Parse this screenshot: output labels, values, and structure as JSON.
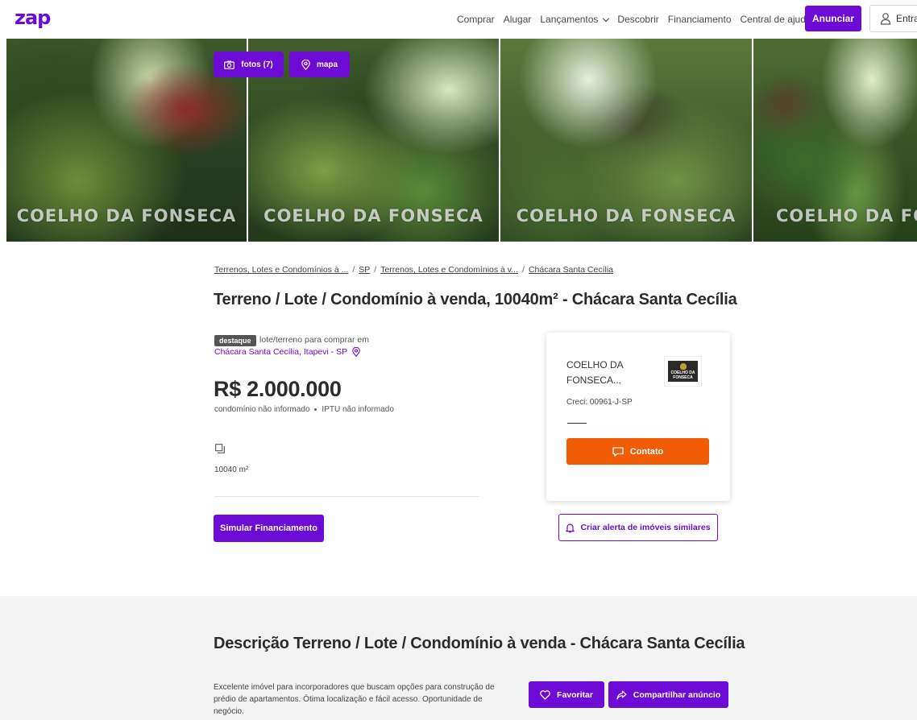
{
  "header": {
    "logo": "zap",
    "nav": [
      {
        "label": "Comprar"
      },
      {
        "label": "Alugar"
      },
      {
        "label": "Lançamentos",
        "dropdown": true
      },
      {
        "label": "Descobrir"
      },
      {
        "label": "Financiamento"
      },
      {
        "label": "Central de ajuda"
      }
    ],
    "anunciar_label": "Anunciar",
    "entrar_label": "Entrar"
  },
  "gallery": {
    "fotos_label": "fotos (7)",
    "mapa_label": "mapa",
    "watermark": "COELHO DA FONSECA"
  },
  "breadcrumb": [
    "Terrenos, Lotes e Condomínios à ...",
    "SP",
    "Terrenos, Lotes e Condomínios à v...",
    "Chácara Santa Cecília"
  ],
  "listing": {
    "title": "Terreno / Lote / Condomínio à venda, 10040m² - Chácara Santa Cecília",
    "badge": "destaque",
    "subtype": "lote/terreno para comprar em",
    "location": "Chácara Santa Cecília, Itapevi - SP",
    "price": "R$ 2.000.000",
    "condominio": "condomínio não informado",
    "iptu": "IPTU não informado",
    "area": "10040 m²",
    "simular_label": "Simular Financiamento"
  },
  "advertiser": {
    "name": "COELHO DA FONSECA...",
    "logo_text": "COELHO DA FONSECA",
    "creci": "Creci: 00961-J-SP",
    "contato_label": "Contato",
    "alerta_label": "Criar alerta de imóveis similares"
  },
  "description": {
    "title": "Descrição Terreno / Lote / Condomínio à venda - Chácara Santa Cecília",
    "text": "Excelente imóvel para incorporadores que buscam opções para construção de prédio de apartamentos. Ótima localização e fácil acesso. Oportunidade de negócio.",
    "favoritar_label": "Favoritar",
    "compartilhar_label": "Compartilhar anúncio"
  },
  "colors": {
    "brand": "#6d0ad6",
    "contact": "#f25c05"
  }
}
